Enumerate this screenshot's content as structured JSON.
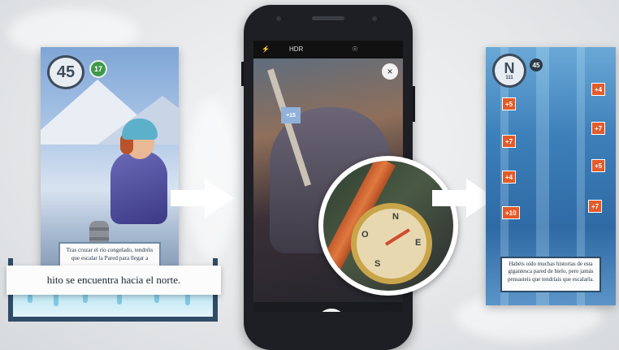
{
  "left_card": {
    "number": "45",
    "green_badge": "17",
    "text": "Tras cruzar el río congelado, tendréis que escalar la Pared para llegar a"
  },
  "caption": "hito se encuentra hacia el norte.",
  "phone": {
    "hdr_label": "HDR",
    "close_label": "×",
    "viewfinder_card_label": "+15",
    "compass_letters": {
      "n": "N",
      "e": "E",
      "s": "S",
      "o": "O"
    }
  },
  "right_card": {
    "letter": "N",
    "letter_sub": "111",
    "dark_badge": "45",
    "tags": [
      "+5",
      "+4",
      "+7",
      "+7",
      "+4",
      "+5",
      "+10",
      "+7"
    ],
    "text": "Habéis oído muchas historias de esta gigantesca pared de hielo, pero jamás pensasteis que tendríais que escalarla."
  }
}
